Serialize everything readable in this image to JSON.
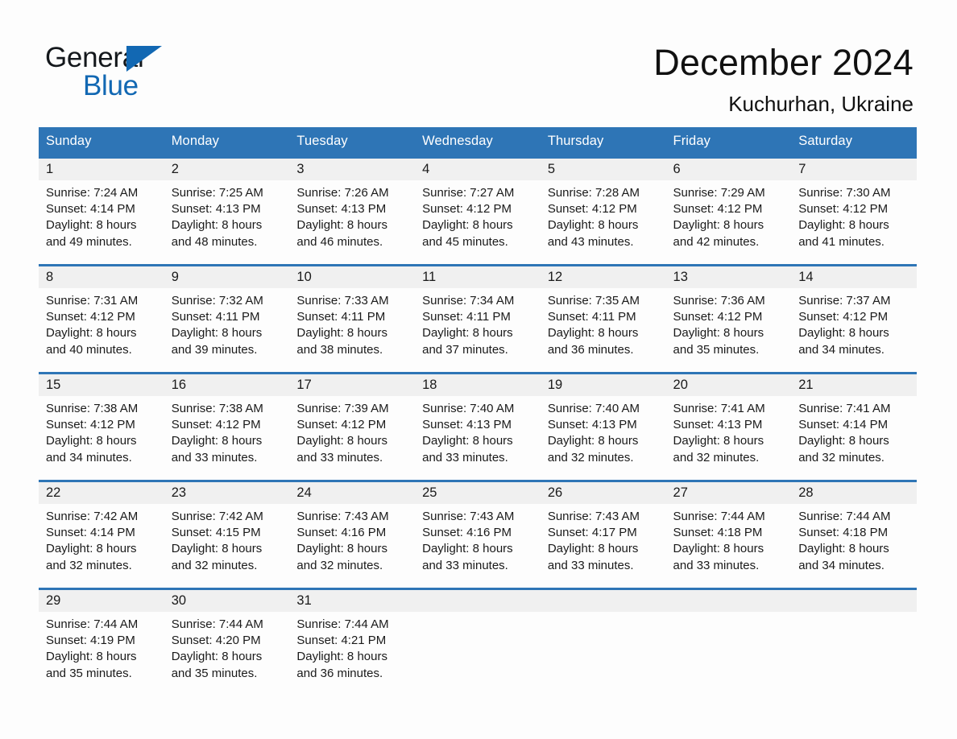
{
  "brand": {
    "name_dark": "General",
    "name_blue": "Blue",
    "accent_color": "#1268b3"
  },
  "header": {
    "month_title": "December 2024",
    "location": "Kuchurhan, Ukraine",
    "header_bg_color": "#2e75b6"
  },
  "weekday_headers": [
    "Sunday",
    "Monday",
    "Tuesday",
    "Wednesday",
    "Thursday",
    "Friday",
    "Saturday"
  ],
  "weeks": [
    [
      {
        "day": "1",
        "sunrise": "Sunrise: 7:24 AM",
        "sunset": "Sunset: 4:14 PM",
        "daylight_line1": "Daylight: 8 hours",
        "daylight_line2": "and 49 minutes."
      },
      {
        "day": "2",
        "sunrise": "Sunrise: 7:25 AM",
        "sunset": "Sunset: 4:13 PM",
        "daylight_line1": "Daylight: 8 hours",
        "daylight_line2": "and 48 minutes."
      },
      {
        "day": "3",
        "sunrise": "Sunrise: 7:26 AM",
        "sunset": "Sunset: 4:13 PM",
        "daylight_line1": "Daylight: 8 hours",
        "daylight_line2": "and 46 minutes."
      },
      {
        "day": "4",
        "sunrise": "Sunrise: 7:27 AM",
        "sunset": "Sunset: 4:12 PM",
        "daylight_line1": "Daylight: 8 hours",
        "daylight_line2": "and 45 minutes."
      },
      {
        "day": "5",
        "sunrise": "Sunrise: 7:28 AM",
        "sunset": "Sunset: 4:12 PM",
        "daylight_line1": "Daylight: 8 hours",
        "daylight_line2": "and 43 minutes."
      },
      {
        "day": "6",
        "sunrise": "Sunrise: 7:29 AM",
        "sunset": "Sunset: 4:12 PM",
        "daylight_line1": "Daylight: 8 hours",
        "daylight_line2": "and 42 minutes."
      },
      {
        "day": "7",
        "sunrise": "Sunrise: 7:30 AM",
        "sunset": "Sunset: 4:12 PM",
        "daylight_line1": "Daylight: 8 hours",
        "daylight_line2": "and 41 minutes."
      }
    ],
    [
      {
        "day": "8",
        "sunrise": "Sunrise: 7:31 AM",
        "sunset": "Sunset: 4:12 PM",
        "daylight_line1": "Daylight: 8 hours",
        "daylight_line2": "and 40 minutes."
      },
      {
        "day": "9",
        "sunrise": "Sunrise: 7:32 AM",
        "sunset": "Sunset: 4:11 PM",
        "daylight_line1": "Daylight: 8 hours",
        "daylight_line2": "and 39 minutes."
      },
      {
        "day": "10",
        "sunrise": "Sunrise: 7:33 AM",
        "sunset": "Sunset: 4:11 PM",
        "daylight_line1": "Daylight: 8 hours",
        "daylight_line2": "and 38 minutes."
      },
      {
        "day": "11",
        "sunrise": "Sunrise: 7:34 AM",
        "sunset": "Sunset: 4:11 PM",
        "daylight_line1": "Daylight: 8 hours",
        "daylight_line2": "and 37 minutes."
      },
      {
        "day": "12",
        "sunrise": "Sunrise: 7:35 AM",
        "sunset": "Sunset: 4:11 PM",
        "daylight_line1": "Daylight: 8 hours",
        "daylight_line2": "and 36 minutes."
      },
      {
        "day": "13",
        "sunrise": "Sunrise: 7:36 AM",
        "sunset": "Sunset: 4:12 PM",
        "daylight_line1": "Daylight: 8 hours",
        "daylight_line2": "and 35 minutes."
      },
      {
        "day": "14",
        "sunrise": "Sunrise: 7:37 AM",
        "sunset": "Sunset: 4:12 PM",
        "daylight_line1": "Daylight: 8 hours",
        "daylight_line2": "and 34 minutes."
      }
    ],
    [
      {
        "day": "15",
        "sunrise": "Sunrise: 7:38 AM",
        "sunset": "Sunset: 4:12 PM",
        "daylight_line1": "Daylight: 8 hours",
        "daylight_line2": "and 34 minutes."
      },
      {
        "day": "16",
        "sunrise": "Sunrise: 7:38 AM",
        "sunset": "Sunset: 4:12 PM",
        "daylight_line1": "Daylight: 8 hours",
        "daylight_line2": "and 33 minutes."
      },
      {
        "day": "17",
        "sunrise": "Sunrise: 7:39 AM",
        "sunset": "Sunset: 4:12 PM",
        "daylight_line1": "Daylight: 8 hours",
        "daylight_line2": "and 33 minutes."
      },
      {
        "day": "18",
        "sunrise": "Sunrise: 7:40 AM",
        "sunset": "Sunset: 4:13 PM",
        "daylight_line1": "Daylight: 8 hours",
        "daylight_line2": "and 33 minutes."
      },
      {
        "day": "19",
        "sunrise": "Sunrise: 7:40 AM",
        "sunset": "Sunset: 4:13 PM",
        "daylight_line1": "Daylight: 8 hours",
        "daylight_line2": "and 32 minutes."
      },
      {
        "day": "20",
        "sunrise": "Sunrise: 7:41 AM",
        "sunset": "Sunset: 4:13 PM",
        "daylight_line1": "Daylight: 8 hours",
        "daylight_line2": "and 32 minutes."
      },
      {
        "day": "21",
        "sunrise": "Sunrise: 7:41 AM",
        "sunset": "Sunset: 4:14 PM",
        "daylight_line1": "Daylight: 8 hours",
        "daylight_line2": "and 32 minutes."
      }
    ],
    [
      {
        "day": "22",
        "sunrise": "Sunrise: 7:42 AM",
        "sunset": "Sunset: 4:14 PM",
        "daylight_line1": "Daylight: 8 hours",
        "daylight_line2": "and 32 minutes."
      },
      {
        "day": "23",
        "sunrise": "Sunrise: 7:42 AM",
        "sunset": "Sunset: 4:15 PM",
        "daylight_line1": "Daylight: 8 hours",
        "daylight_line2": "and 32 minutes."
      },
      {
        "day": "24",
        "sunrise": "Sunrise: 7:43 AM",
        "sunset": "Sunset: 4:16 PM",
        "daylight_line1": "Daylight: 8 hours",
        "daylight_line2": "and 32 minutes."
      },
      {
        "day": "25",
        "sunrise": "Sunrise: 7:43 AM",
        "sunset": "Sunset: 4:16 PM",
        "daylight_line1": "Daylight: 8 hours",
        "daylight_line2": "and 33 minutes."
      },
      {
        "day": "26",
        "sunrise": "Sunrise: 7:43 AM",
        "sunset": "Sunset: 4:17 PM",
        "daylight_line1": "Daylight: 8 hours",
        "daylight_line2": "and 33 minutes."
      },
      {
        "day": "27",
        "sunrise": "Sunrise: 7:44 AM",
        "sunset": "Sunset: 4:18 PM",
        "daylight_line1": "Daylight: 8 hours",
        "daylight_line2": "and 33 minutes."
      },
      {
        "day": "28",
        "sunrise": "Sunrise: 7:44 AM",
        "sunset": "Sunset: 4:18 PM",
        "daylight_line1": "Daylight: 8 hours",
        "daylight_line2": "and 34 minutes."
      }
    ],
    [
      {
        "day": "29",
        "sunrise": "Sunrise: 7:44 AM",
        "sunset": "Sunset: 4:19 PM",
        "daylight_line1": "Daylight: 8 hours",
        "daylight_line2": "and 35 minutes."
      },
      {
        "day": "30",
        "sunrise": "Sunrise: 7:44 AM",
        "sunset": "Sunset: 4:20 PM",
        "daylight_line1": "Daylight: 8 hours",
        "daylight_line2": "and 35 minutes."
      },
      {
        "day": "31",
        "sunrise": "Sunrise: 7:44 AM",
        "sunset": "Sunset: 4:21 PM",
        "daylight_line1": "Daylight: 8 hours",
        "daylight_line2": "and 36 minutes."
      },
      {
        "day": "",
        "sunrise": "",
        "sunset": "",
        "daylight_line1": "",
        "daylight_line2": ""
      },
      {
        "day": "",
        "sunrise": "",
        "sunset": "",
        "daylight_line1": "",
        "daylight_line2": ""
      },
      {
        "day": "",
        "sunrise": "",
        "sunset": "",
        "daylight_line1": "",
        "daylight_line2": ""
      },
      {
        "day": "",
        "sunrise": "",
        "sunset": "",
        "daylight_line1": "",
        "daylight_line2": ""
      }
    ]
  ]
}
